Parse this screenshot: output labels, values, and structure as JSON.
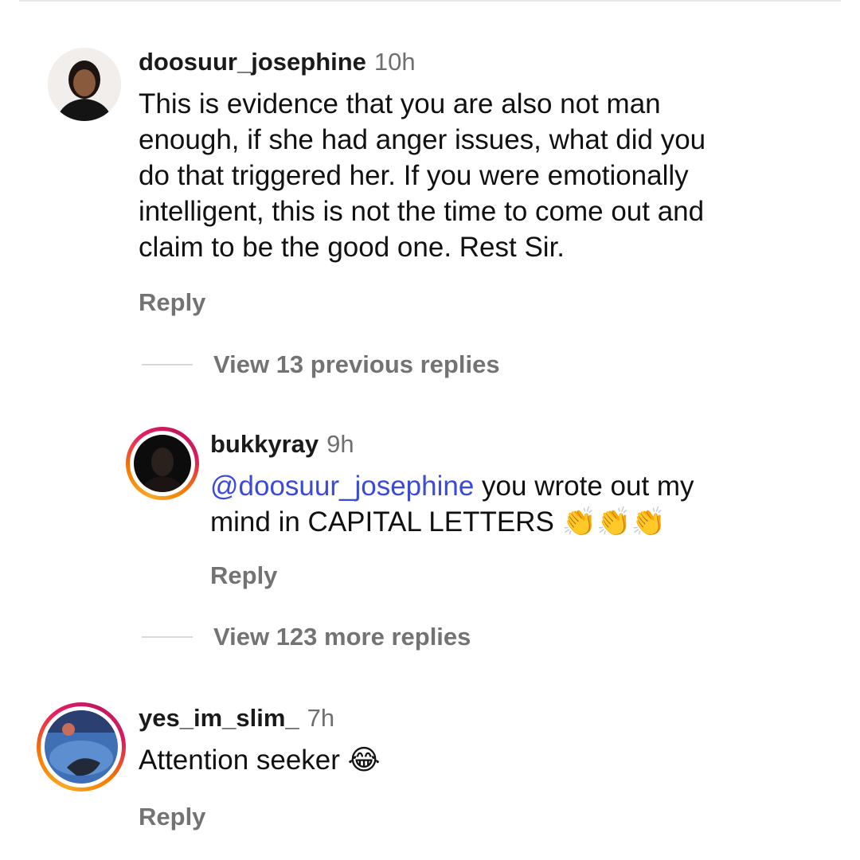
{
  "comments": [
    {
      "username": "doosuur_josephine",
      "time": "10h",
      "lines": [
        "This is evidence that you are also not man",
        "enough, if she had anger issues, what did you",
        "do that triggered her. If you were emotionally",
        "intelligent, this is not the time to come out and",
        "claim to be the good one. Rest Sir."
      ],
      "reply_label": "Reply"
    },
    {
      "username": "bukkyray",
      "time": "9h",
      "mention": "@doosuur_josephine",
      "line1_rest": " you wrote out my",
      "line2": "mind in CAPITAL LETTERS ",
      "emojis": "👏👏👏",
      "reply_label": "Reply"
    },
    {
      "username": "yes_im_slim_",
      "time": "7h",
      "text": "Attention seeker ",
      "emoji": "😂",
      "reply_label": "Reply"
    }
  ],
  "view_previous": "View 13 previous replies",
  "view_more": "View 123 more replies",
  "colors": {
    "mention": "#3a4bd9",
    "muted": "#737373",
    "ring_start": "#f9a825",
    "ring_end": "#d81b60"
  }
}
